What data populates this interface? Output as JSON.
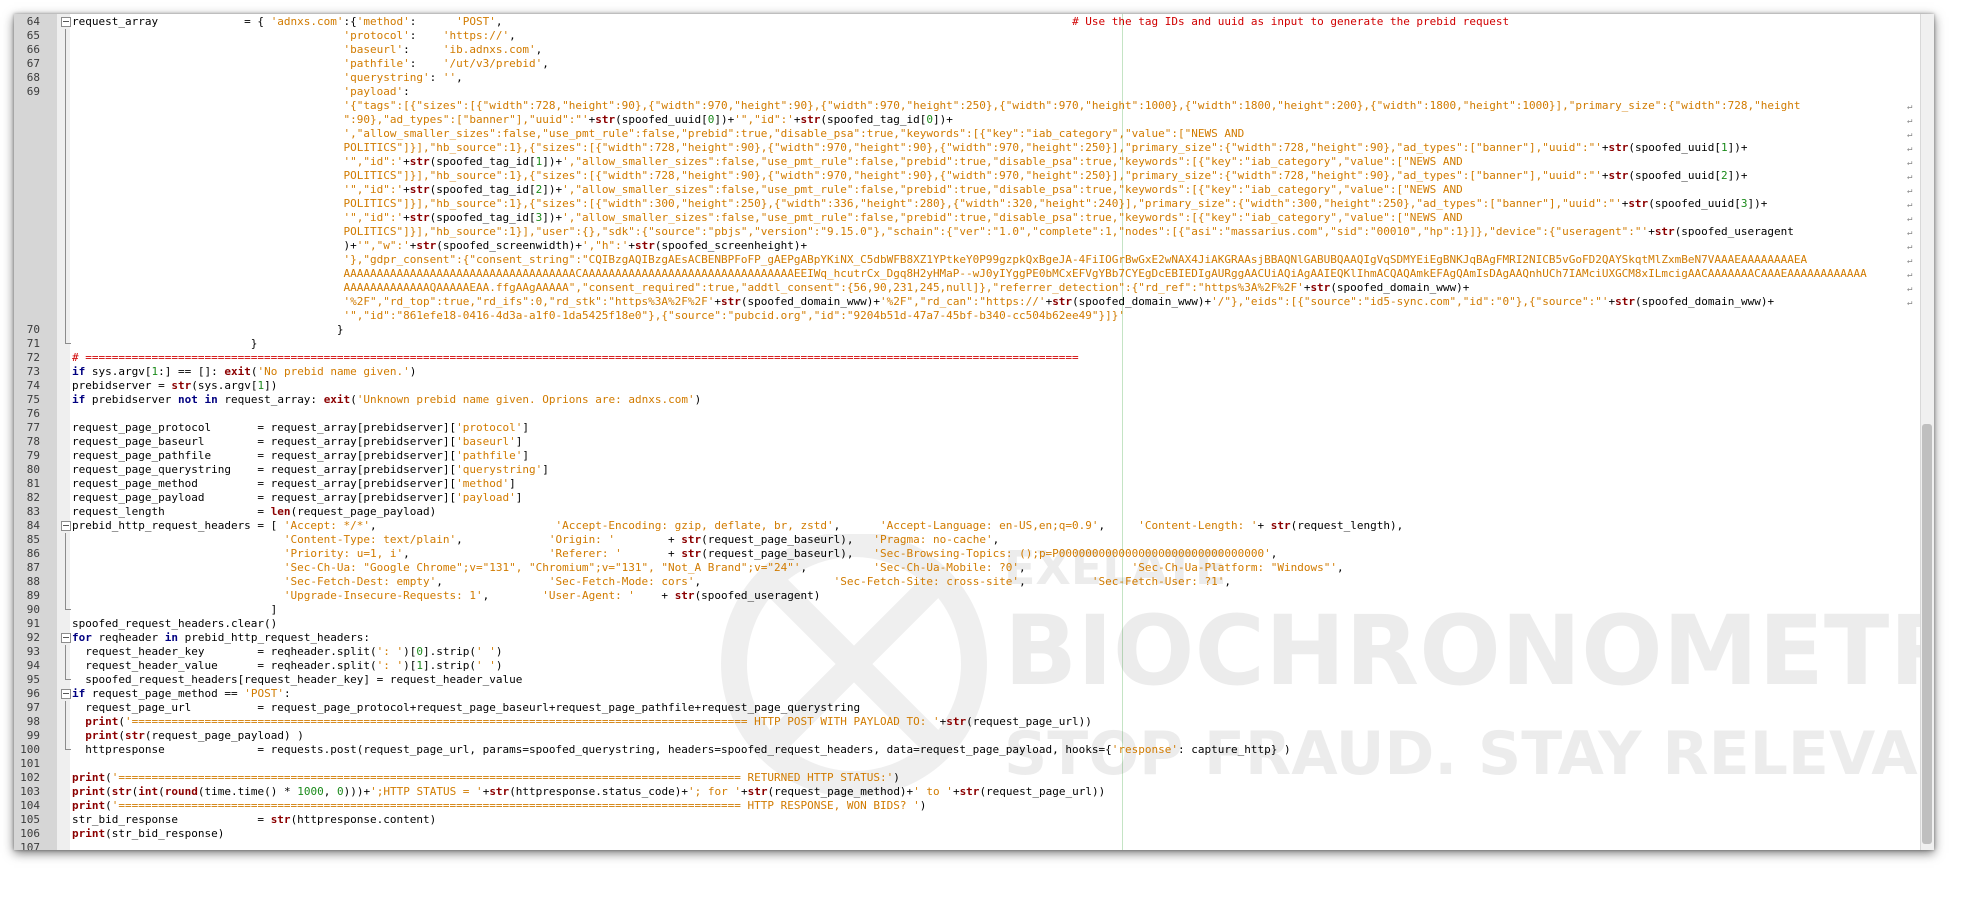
{
  "editor": {
    "lines": [
      {
        "no": "64",
        "fold": "box",
        "html": "request_array             = { <span class='s'>'adnxs.com'</span>:{<span class='s'>'method'</span>:      <span class='s'>'POST'</span>,                                                                                      <span class='c'># Use the tag IDs and uuid as input to generate the prebid request</span>"
      },
      {
        "no": "65",
        "fold": "bar",
        "html": "                                         <span class='s'>'protocol'</span>:    <span class='s'>'https://'</span>,"
      },
      {
        "no": "66",
        "fold": "bar",
        "html": "                                         <span class='s'>'baseurl'</span>:     <span class='s'>'ib.adnxs.com'</span>,"
      },
      {
        "no": "67",
        "fold": "bar",
        "html": "                                         <span class='s'>'pathfile'</span>:    <span class='s'>'/ut/v3/prebid'</span>,"
      },
      {
        "no": "68",
        "fold": "bar",
        "html": "                                         <span class='s'>'querystring'</span>: <span class='s'>''</span>,"
      },
      {
        "no": "69",
        "fold": "bar",
        "html": "                                         <span class='s'>'payload'</span>:"
      },
      {
        "no": "",
        "fold": "bar",
        "wrap": true,
        "html": "                                         <span class='s'>'{\"tags\":[{\"sizes\":[{\"width\":728,\"height\":90},{\"width\":970,\"height\":90},{\"width\":970,\"height\":250},{\"width\":970,\"height\":1000},{\"width\":1800,\"height\":200},{\"width\":1800,\"height\":1000}],\"primary_size\":{\"width\":728,\"height</span>"
      },
      {
        "no": "",
        "fold": "bar",
        "wrap": true,
        "html": "                                         <span class='s'>\":90},\"ad_types\":[\"banner\"],\"uuid\":\"'</span>+<span class='f'>str</span>(spoofed_uuid[<span class='n'>0</span>])+<span class='s'>'\",\"id\":'</span>+<span class='f'>str</span>(spoofed_tag_id[<span class='n'>0</span>])+"
      },
      {
        "no": "",
        "fold": "bar",
        "wrap": true,
        "html": "                                         <span class='s'>',\"allow_smaller_sizes\":false,\"use_pmt_rule\":false,\"prebid\":true,\"disable_psa\":true,\"keywords\":[{\"key\":\"iab_category\",\"value\":[\"NEWS AND</span>"
      },
      {
        "no": "",
        "fold": "bar",
        "wrap": true,
        "html": "                                         <span class='s'>POLITICS\"]}],\"hb_source\":1},{\"sizes\":[{\"width\":728,\"height\":90},{\"width\":970,\"height\":90},{\"width\":970,\"height\":250}],\"primary_size\":{\"width\":728,\"height\":90},\"ad_types\":[\"banner\"],\"uuid\":\"'</span>+<span class='f'>str</span>(spoofed_uuid[<span class='n'>1</span>])+"
      },
      {
        "no": "",
        "fold": "bar",
        "wrap": true,
        "html": "                                         <span class='s'>'\",\"id\":'</span>+<span class='f'>str</span>(spoofed_tag_id[<span class='n'>1</span>])+<span class='s'>',\"allow_smaller_sizes\":false,\"use_pmt_rule\":false,\"prebid\":true,\"disable_psa\":true,\"keywords\":[{\"key\":\"iab_category\",\"value\":[\"NEWS AND</span>"
      },
      {
        "no": "",
        "fold": "bar",
        "wrap": true,
        "html": "                                         <span class='s'>POLITICS\"]}],\"hb_source\":1},{\"sizes\":[{\"width\":728,\"height\":90},{\"width\":970,\"height\":90},{\"width\":970,\"height\":250}],\"primary_size\":{\"width\":728,\"height\":90},\"ad_types\":[\"banner\"],\"uuid\":\"'</span>+<span class='f'>str</span>(spoofed_uuid[<span class='n'>2</span>])+"
      },
      {
        "no": "",
        "fold": "bar",
        "wrap": true,
        "html": "                                         <span class='s'>'\",\"id\":'</span>+<span class='f'>str</span>(spoofed_tag_id[<span class='n'>2</span>])+<span class='s'>',\"allow_smaller_sizes\":false,\"use_pmt_rule\":false,\"prebid\":true,\"disable_psa\":true,\"keywords\":[{\"key\":\"iab_category\",\"value\":[\"NEWS AND</span>"
      },
      {
        "no": "",
        "fold": "bar",
        "wrap": true,
        "html": "                                         <span class='s'>POLITICS\"]}],\"hb_source\":1},{\"sizes\":[{\"width\":300,\"height\":250},{\"width\":336,\"height\":280},{\"width\":320,\"height\":240}],\"primary_size\":{\"width\":300,\"height\":250},\"ad_types\":[\"banner\"],\"uuid\":\"'</span>+<span class='f'>str</span>(spoofed_uuid[<span class='n'>3</span>])+"
      },
      {
        "no": "",
        "fold": "bar",
        "wrap": true,
        "html": "                                         <span class='s'>'\",\"id\":'</span>+<span class='f'>str</span>(spoofed_tag_id[<span class='n'>3</span>])+<span class='s'>',\"allow_smaller_sizes\":false,\"use_pmt_rule\":false,\"prebid\":true,\"disable_psa\":true,\"keywords\":[{\"key\":\"iab_category\",\"value\":[\"NEWS AND</span>"
      },
      {
        "no": "",
        "fold": "bar",
        "wrap": true,
        "html": "                                         <span class='s'>POLITICS\"]}],\"hb_source\":1}],\"user\":{},\"sdk\":{\"source\":\"pbjs\",\"version\":\"9.15.0\"},\"schain\":{\"ver\":\"1.0\",\"complete\":1,\"nodes\":[{\"asi\":\"massarius.com\",\"sid\":\"00010\",\"hp\":1}]},\"device\":{\"useragent\":\"'</span>+<span class='f'>str</span>(spoofed_useragent"
      },
      {
        "no": "",
        "fold": "bar",
        "wrap": true,
        "html": "                                         )+<span class='s'>'\",\"w\":'</span>+<span class='f'>str</span>(spoofed_screenwidth)+<span class='s'>',\"h\":'</span>+<span class='f'>str</span>(spoofed_screenheight)+"
      },
      {
        "no": "",
        "fold": "bar",
        "wrap": true,
        "html": "                                         <span class='s'>'},\"gdpr_consent\":{\"consent_string\":\"CQIBzgAQIBzgAEsACBENBPFoFP_gAEPgABpYKiNX_C5dbWFB8XZ1YPtkeY0P99gzpkQxBgeJA-4FiIOGrBwGxE2wNAX4JiAKGRAAsjBBAQNlGABUBQAAQIgVqSDMYEiEgBNKJqBAgFMRI2NICB5vGoFD2QAYSkqtMlZxmBeN7VAAAEAAAAAAAAEA</span>"
      },
      {
        "no": "",
        "fold": "bar",
        "wrap": true,
        "html": "                                         <span class='s'>AAAAAAAAAAAAAAAAAAAAAAAAAAAAAAAAAAACAAAAAAAAAAAAAAAAAAAAAAAAAAAAAAAAEEIWq_hcutrCx_Dgq8H2yHMaP--wJ0yIYggPE0bMCxEFVgYBb7CYEgDcEBIEDIgAURggAACUiAQiAgAAIEQKlIhmACQAQAmkEFAgQAmIsDAgAAQnhUCh7IAMciUXGCM8xILmcigAACAAAAAAACAAAEAAAAAAAAAAAA</span>"
      },
      {
        "no": "",
        "fold": "bar",
        "wrap": true,
        "html": "                                         <span class='s'>AAAAAAAAAAAAAQAAAAAEAA.ffgAAgAAAAA\",\"consent_required\":true,\"addtl_consent\":{56,90,231,245,null]},\"referrer_detection\":{\"rd_ref\":\"https%3A%2F%2F'</span>+<span class='f'>str</span>(spoofed_domain_www)+"
      },
      {
        "no": "",
        "fold": "bar",
        "wrap": true,
        "html": "                                         <span class='s'>'%2F\",\"rd_top\":true,\"rd_ifs\":0,\"rd_stk\":\"https%3A%2F%2F'</span>+<span class='f'>str</span>(spoofed_domain_www)+<span class='s'>'%2F\",\"rd_can\":\"https://'</span>+<span class='f'>str</span>(spoofed_domain_www)+<span class='s'>'/\"},\"eids\":[{\"source\":\"id5-sync.com\",\"id\":\"0\"},{\"source\":\"'</span>+<span class='f'>str</span>(spoofed_domain_www)+"
      },
      {
        "no": "",
        "fold": "bar",
        "html": "                                         <span class='s'>'\",\"id\":\"861efe18-0416-4d3a-a1f0-1da5425f18e0\"},{\"source\":\"pubcid.org\",\"id\":\"9204b51d-47a7-45bf-b340-cc504b62ee49\"}]}'</span>"
      },
      {
        "no": "70",
        "fold": "bar",
        "html": "                                        }"
      },
      {
        "no": "71",
        "fold": "end",
        "html": "                           }"
      },
      {
        "no": "72",
        "fold": "",
        "html": "<span class='c'># ======================================================================================================================================================</span>"
      },
      {
        "no": "73",
        "fold": "",
        "html": "<span class='k'>if</span> sys.argv[<span class='n'>1</span>:] == []: <span class='f'>exit</span>(<span class='s'>'No prebid name given.'</span>)"
      },
      {
        "no": "74",
        "fold": "",
        "html": "prebidserver = <span class='f'>str</span>(sys.argv[<span class='n'>1</span>])"
      },
      {
        "no": "75",
        "fold": "",
        "html": "<span class='k'>if</span> prebidserver <span class='k'>not in</span> request_array: <span class='f'>exit</span>(<span class='s'>'Unknown prebid name given. Oprions are: adnxs.com'</span>)"
      },
      {
        "no": "76",
        "fold": "",
        "html": ""
      },
      {
        "no": "77",
        "fold": "",
        "html": "request_page_protocol       = request_array[prebidserver][<span class='s'>'protocol'</span>]"
      },
      {
        "no": "78",
        "fold": "",
        "html": "request_page_baseurl        = request_array[prebidserver][<span class='s'>'baseurl'</span>]"
      },
      {
        "no": "79",
        "fold": "",
        "html": "request_page_pathfile       = request_array[prebidserver][<span class='s'>'pathfile'</span>]"
      },
      {
        "no": "80",
        "fold": "",
        "html": "request_page_querystring    = request_array[prebidserver][<span class='s'>'querystring'</span>]"
      },
      {
        "no": "81",
        "fold": "",
        "html": "request_page_method         = request_array[prebidserver][<span class='s'>'method'</span>]"
      },
      {
        "no": "82",
        "fold": "",
        "html": "request_page_payload        = request_array[prebidserver][<span class='s'>'payload'</span>]"
      },
      {
        "no": "83",
        "fold": "",
        "html": "request_length              = <span class='f'>len</span>(request_page_payload)"
      },
      {
        "no": "84",
        "fold": "box",
        "html": "prebid_http_request_headers = [ <span class='s'>'Accept: */*'</span>,                           <span class='s'>'Accept-Encoding: gzip, deflate, br, zstd'</span>,      <span class='s'>'Accept-Language: en-US,en;q=0.9'</span>,     <span class='s'>'Content-Length: '</span>+ <span class='f'>str</span>(request_length),"
      },
      {
        "no": "85",
        "fold": "bar",
        "html": "                                <span class='s'>'Content-Type: text/plain'</span>,             <span class='s'>'Origin: '</span>        + <span class='f'>str</span>(request_page_baseurl),   <span class='s'>'Pragma: no-cache'</span>,"
      },
      {
        "no": "86",
        "fold": "bar",
        "html": "                                <span class='s'>'Priority: u=1, i'</span>,                     <span class='s'>'Referer: '</span>       + <span class='f'>str</span>(request_page_baseurl),   <span class='s'>'Sec-Browsing-Topics: ();p=P0000000000000000000000000000000'</span>,"
      },
      {
        "no": "87",
        "fold": "bar",
        "html": "                                <span class='s'>'Sec-Ch-Ua: \"Google Chrome\";v=\"131\", \"Chromium\";v=\"131\", \"Not_A Brand\";v=\"24\"'</span>,          <span class='s'>'Sec-Ch-Ua-Mobile: ?0'</span>,                <span class='s'>'Sec-Ch-Ua-Platform: \"Windows\"'</span>,"
      },
      {
        "no": "88",
        "fold": "bar",
        "html": "                                <span class='s'>'Sec-Fetch-Dest: empty'</span>,                <span class='s'>'Sec-Fetch-Mode: cors'</span>,                    <span class='s'>'Sec-Fetch-Site: cross-site'</span>,          <span class='s'>'Sec-Fetch-User: ?1'</span>,"
      },
      {
        "no": "89",
        "fold": "bar",
        "html": "                                <span class='s'>'Upgrade-Insecure-Requests: 1'</span>,        <span class='s'>'User-Agent: '</span>    + <span class='f'>str</span>(spoofed_useragent)"
      },
      {
        "no": "90",
        "fold": "end",
        "html": "                              ]"
      },
      {
        "no": "91",
        "fold": "",
        "html": "spoofed_request_headers.clear()"
      },
      {
        "no": "92",
        "fold": "box",
        "html": "<span class='k'>for</span> reqheader <span class='k'>in</span> prebid_http_request_headers:"
      },
      {
        "no": "93",
        "fold": "bar",
        "html": "  request_header_key        = reqheader.split(<span class='s'>': '</span>)[<span class='n'>0</span>].strip(<span class='s'>' '</span>)"
      },
      {
        "no": "94",
        "fold": "bar",
        "html": "  request_header_value      = reqheader.split(<span class='s'>': '</span>)[<span class='n'>1</span>].strip(<span class='s'>' '</span>)"
      },
      {
        "no": "95",
        "fold": "end",
        "html": "  spoofed_request_headers[request_header_key] = request_header_value"
      },
      {
        "no": "96",
        "fold": "box",
        "html": "<span class='k'>if</span> request_page_method == <span class='s'>'POST'</span>:"
      },
      {
        "no": "97",
        "fold": "bar",
        "html": "  request_page_url          = request_page_protocol+request_page_baseurl+request_page_pathfile+request_page_querystring"
      },
      {
        "no": "98",
        "fold": "bar",
        "html": "  <span class='f'>print</span>(<span class='s'>'============================================================================================= HTTP POST WITH PAYLOAD TO: '</span>+<span class='f'>str</span>(request_page_url))"
      },
      {
        "no": "99",
        "fold": "bar",
        "html": "  <span class='f'>print</span>(<span class='f'>str</span>(request_page_payload) )"
      },
      {
        "no": "100",
        "fold": "end",
        "html": "  httpresponse              = requests.post(request_page_url, params=spoofed_querystring, headers=spoofed_request_headers, data=request_page_payload, hooks={<span class='s'>'response'</span>: capture_http} )"
      },
      {
        "no": "101",
        "fold": "",
        "html": ""
      },
      {
        "no": "102",
        "fold": "",
        "html": "<span class='f'>print</span>(<span class='s'>'============================================================================================== RETURNED HTTP STATUS:'</span>)"
      },
      {
        "no": "103",
        "fold": "",
        "html": "<span class='f'>print</span>(<span class='f'>str</span>(<span class='f'>int</span>(<span class='f'>round</span>(time.time() * <span class='n'>1000</span>, <span class='n'>0</span>)))+<span class='s'>';HTTP STATUS = '</span>+<span class='f'>str</span>(httpresponse.status_code)+<span class='s'>'; for '</span>+<span class='f'>str</span>(request_page_method)+<span class='s'>' to '</span>+<span class='f'>str</span>(request_page_url))"
      },
      {
        "no": "104",
        "fold": "",
        "html": "<span class='f'>print</span>(<span class='s'>'============================================================================================== HTTP RESPONSE, WON BIDS? '</span>)"
      },
      {
        "no": "105",
        "fold": "",
        "html": "str_bid_response            = <span class='f'>str</span>(httpresponse.content)"
      },
      {
        "no": "106",
        "fold": "",
        "html": "<span class='f'>print</span>(str_bid_response)"
      },
      {
        "no": "107",
        "fold": "",
        "html": ""
      }
    ]
  },
  "watermark": {
    "line1": "EXELATE",
    "line2": "BIOCHRONOMETRICS",
    "line3": "STOP FRAUD. STAY RELEVANT"
  }
}
